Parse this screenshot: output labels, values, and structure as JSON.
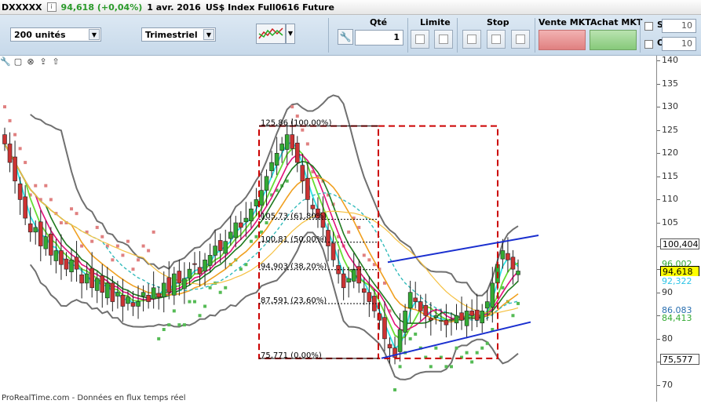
{
  "header": {
    "symbol": "DXXXXX",
    "info_icon": "i",
    "price_change": "94,618 (+0,04%)",
    "date": "1 avr. 2016",
    "instrument": "US$ Index Full0616 Future"
  },
  "toolbar": {
    "quantity_select": "200 unités",
    "period_select": "Trimestriel",
    "qty_label": "Qté",
    "qty_value": "1",
    "limit_label": "Limite",
    "stop_label": "Stop",
    "sell_market_label": "Vente MKT",
    "buy_market_label": "Achat MKT",
    "s_label": "S",
    "o_label": "O",
    "s_value": "10",
    "o_value": "10"
  },
  "y_axis": {
    "ticks": [
      "140",
      "135",
      "130",
      "125",
      "120",
      "115",
      "110",
      "105",
      "100",
      "95",
      "90",
      "85",
      "80",
      "75",
      "70"
    ]
  },
  "price_labels": [
    {
      "text": "100,404",
      "bg": "#ffffff",
      "fg": "#000000",
      "border": "#555555",
      "value": 100.4
    },
    {
      "text": "96,002",
      "bg": "#ffffff",
      "fg": "#33aa33",
      "border": "",
      "value": 96.0
    },
    {
      "text": "94,618",
      "bg": "#ffff00",
      "fg": "#000000",
      "border": "#000000",
      "value": 94.6
    },
    {
      "text": "92,322",
      "bg": "#ffffff",
      "fg": "#2ec4e6",
      "border": "",
      "value": 92.3
    },
    {
      "text": "86,083",
      "bg": "#ffffff",
      "fg": "#2a6fb0",
      "border": "",
      "value": 86.1
    },
    {
      "text": "84,413",
      "bg": "#ffffff",
      "fg": "#33aa33",
      "border": "",
      "value": 84.4
    },
    {
      "text": "75,577",
      "bg": "#ffffff",
      "fg": "#000000",
      "border": "#555555",
      "value": 75.6
    }
  ],
  "fib_levels": [
    {
      "label": "125,86 (100,00%)",
      "value": 125.86
    },
    {
      "label": "105,73 (61,80%)",
      "value": 105.73
    },
    {
      "label": "100,81 (50,00%)",
      "value": 100.81
    },
    {
      "label": "94,903 (38,20%)",
      "value": 94.9
    },
    {
      "label": "87,591 (23,60%)",
      "value": 87.59
    },
    {
      "label": "75,771 (0,00%)",
      "value": 75.77
    }
  ],
  "bottom_text": "ProRealTime.com - Données en flux temps réel",
  "colors": {
    "price_green": "#2a9a2a",
    "bullish": "#33aa33",
    "bearish": "#cc3333",
    "bollinger": "#707070",
    "sar_red": "#e08080",
    "sar_green": "#55bb55",
    "channel": "#1a2fcf",
    "fib_box": "#cc0000"
  },
  "chart_data": {
    "type": "candlestick",
    "title": "",
    "ylim": [
      70,
      140
    ],
    "close_series": [
      122,
      118,
      114,
      110,
      106,
      103,
      104,
      100,
      102,
      98,
      99,
      96,
      95,
      97,
      95,
      92,
      94,
      91,
      93,
      90,
      92,
      88,
      90,
      87,
      89,
      87,
      88,
      90,
      88,
      91,
      89,
      92,
      90,
      94,
      92,
      93,
      95,
      96,
      94,
      97,
      98,
      100,
      99,
      101,
      103,
      105,
      104,
      106,
      108,
      110,
      112,
      115,
      118,
      120,
      122,
      124,
      121,
      118,
      114,
      110,
      108,
      106,
      104,
      100,
      97,
      94,
      91,
      93,
      95,
      92,
      90,
      88,
      86,
      84,
      80,
      78,
      76,
      82,
      86,
      90,
      88,
      86,
      85,
      84,
      85,
      84,
      83,
      84,
      85,
      84,
      86,
      85,
      84,
      86,
      88,
      92,
      96,
      99,
      97,
      95,
      94.6
    ]
  }
}
